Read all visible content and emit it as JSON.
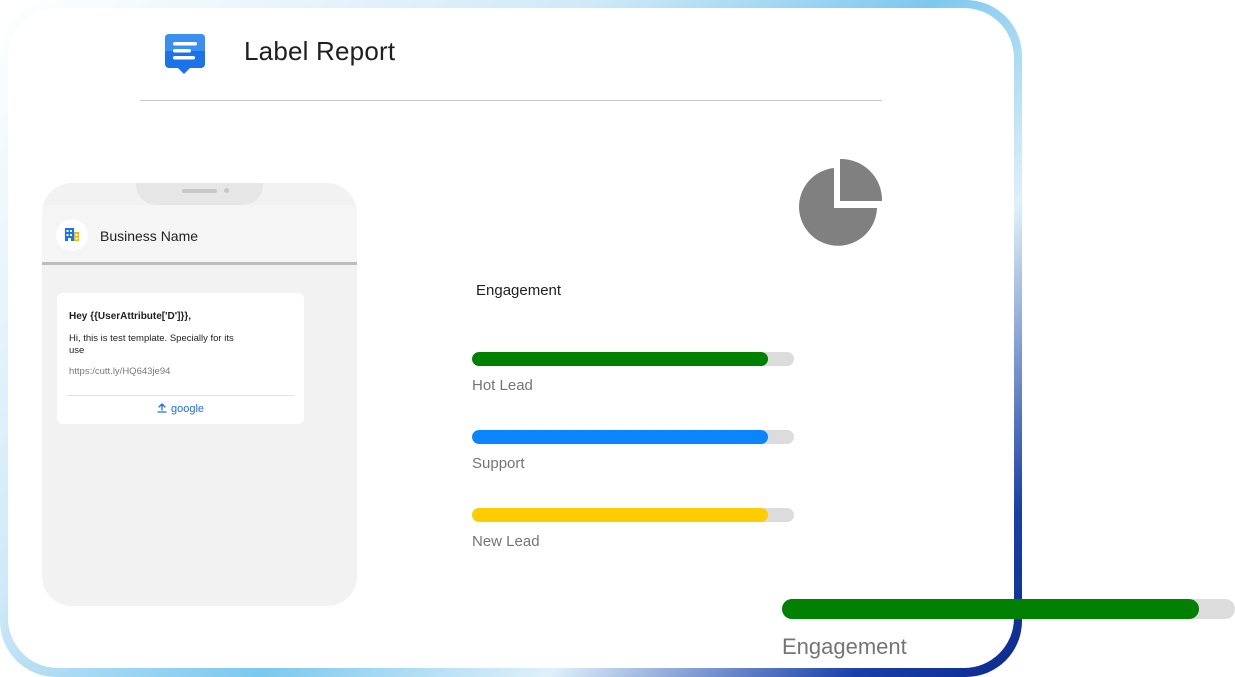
{
  "header": {
    "title": "Label Report",
    "icon": "chat-message-icon",
    "icon_color": "#1a73e8"
  },
  "phone": {
    "business_name": "Business Name",
    "avatar_icon": "building-icon",
    "message": {
      "greeting": "Hey {{UserAttribute['D']}},",
      "body": "Hi, this is test template. Specially for its use",
      "link": "https:/cutt.ly/HQ643je94",
      "action_label": "google",
      "action_icon": "upload-icon",
      "action_color": "#1a73e8"
    }
  },
  "report": {
    "chart_icon": "pie-chart-icon",
    "section_title": "Engagement",
    "bars": [
      {
        "label": "Hot Lead",
        "value_percent": 92,
        "color": "#008000"
      },
      {
        "label": "Support",
        "value_percent": 92,
        "color": "#0a84ff"
      },
      {
        "label": "New Lead",
        "value_percent": 92,
        "color": "#ffcc00"
      }
    ],
    "overlay_bar": {
      "label": "Engagement",
      "value_percent": 92,
      "color": "#008000"
    }
  }
}
